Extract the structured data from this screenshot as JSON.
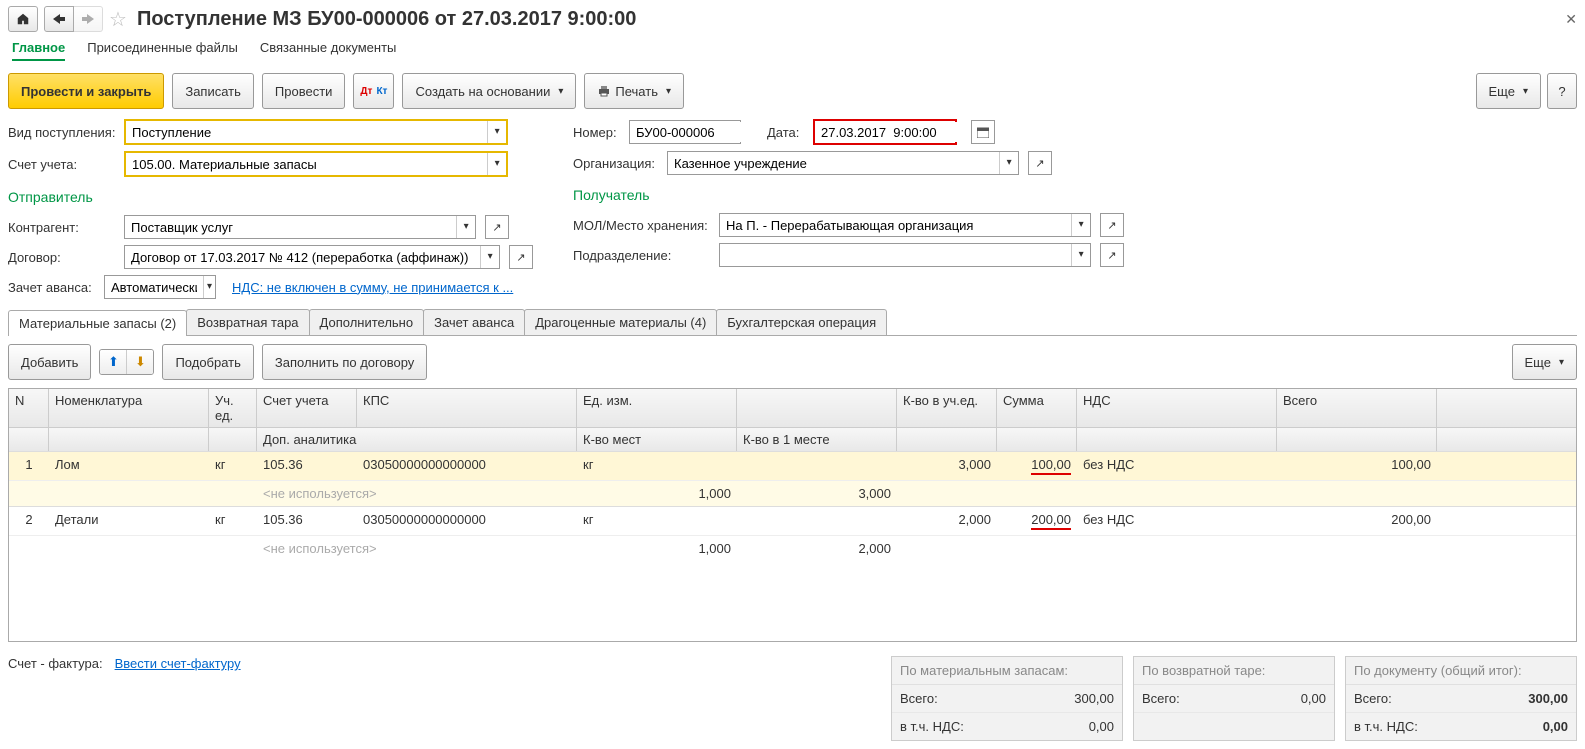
{
  "title": "Поступление МЗ БУ00-000006 от 27.03.2017 9:00:00",
  "nav": {
    "main": "Главное",
    "files": "Присоединенные файлы",
    "related": "Связанные документы"
  },
  "toolbar": {
    "post_close": "Провести и закрыть",
    "save": "Записать",
    "post": "Провести",
    "create_based": "Создать на основании",
    "print": "Печать",
    "more": "Еще"
  },
  "labels": {
    "receipt_type": "Вид поступления:",
    "account": "Счет учета:",
    "number": "Номер:",
    "date": "Дата:",
    "org": "Организация:",
    "sender": "Отправитель",
    "receiver": "Получатель",
    "counterparty": "Контрагент:",
    "contract": "Договор:",
    "mol": "МОЛ/Место хранения:",
    "dept": "Подразделение:",
    "advance": "Зачет аванса:",
    "vat_link": "НДС: не включен в сумму, не принимается к ...",
    "invoice_lbl": "Счет - фактура:",
    "invoice_link": "Ввести счет-фактуру"
  },
  "values": {
    "receipt_type": "Поступление",
    "account": "105.00. Материальные запасы",
    "number": "БУ00-000006",
    "date": "27.03.2017  9:00:00",
    "org": "Казенное учреждение",
    "counterparty": "Поставщик услуг",
    "contract": "Договор от 17.03.2017 № 412 (переработка (аффинаж))",
    "mol": "На П. - Перерабатывающая организация",
    "dept": "",
    "advance": "Автоматически"
  },
  "tabs": {
    "mat": "Материальные запасы (2)",
    "tare": "Возвратная тара",
    "extra": "Дополнительно",
    "adv": "Зачет аванса",
    "prec": "Драгоценные материалы (4)",
    "acc": "Бухгалтерская операция"
  },
  "tb2": {
    "add": "Добавить",
    "pick": "Подобрать",
    "fill": "Заполнить по договору",
    "more": "Еще"
  },
  "cols": {
    "n": "N",
    "nom": "Номенклатура",
    "unit": "Уч. ед.",
    "acct": "Счет учета",
    "kps": "КПС",
    "meas": "Ед. изм.",
    "qty": "К-во в уч.ед.",
    "sum": "Сумма",
    "vat": "НДС",
    "total": "Всего",
    "anal": "Доп. аналитика",
    "places": "К-во мест",
    "perplace": "К-во в 1 месте",
    "unused": "<не используется>"
  },
  "rows": [
    {
      "n": "1",
      "nom": "Лом",
      "unit": "кг",
      "acct": "105.36",
      "kps": "03050000000000000",
      "meas": "кг",
      "qty": "3,000",
      "sum": "100,00",
      "vat": "без НДС",
      "total": "100,00",
      "places": "1,000",
      "perplace": "3,000"
    },
    {
      "n": "2",
      "nom": "Детали",
      "unit": "кг",
      "acct": "105.36",
      "kps": "03050000000000000",
      "meas": "кг",
      "qty": "2,000",
      "sum": "200,00",
      "vat": "без НДС",
      "total": "200,00",
      "places": "1,000",
      "perplace": "2,000"
    }
  ],
  "summary": {
    "mat_head": "По материальным запасам:",
    "tare_head": "По возвратной таре:",
    "doc_head": "По документу (общий итог):",
    "total_lbl": "Всего:",
    "vat_lbl": "в т.ч. НДС:",
    "mat_total": "300,00",
    "mat_vat": "0,00",
    "tare_total": "0,00",
    "doc_total": "300,00",
    "doc_vat": "0,00"
  }
}
